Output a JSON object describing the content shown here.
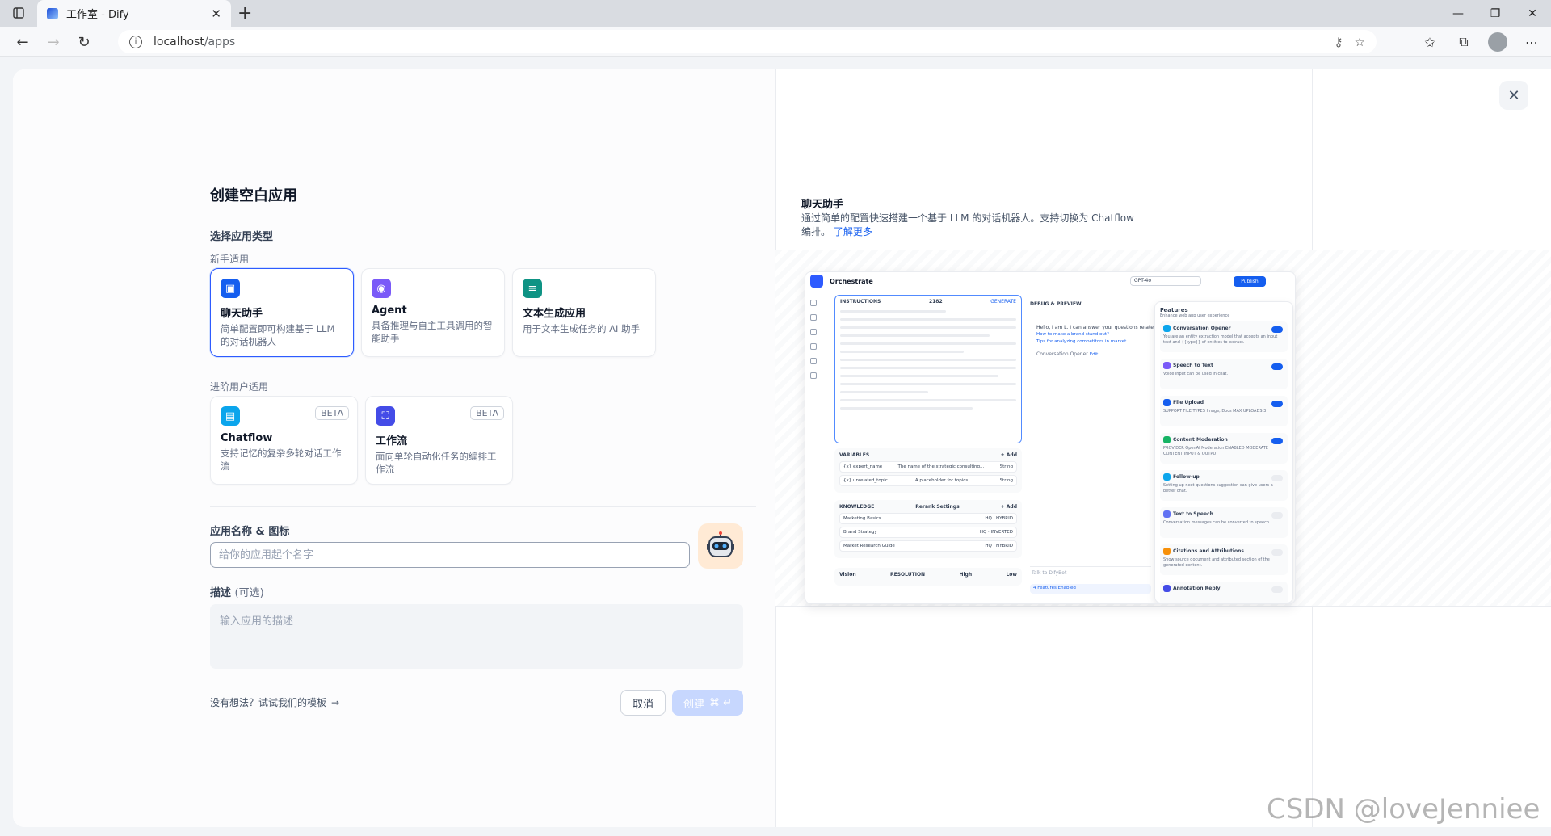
{
  "browser": {
    "tab_title": "工作室 - Dify",
    "url_host": "localhost",
    "url_path": "/apps"
  },
  "modal": {
    "title": "创建空白应用",
    "type_section": "选择应用类型",
    "beginner_label": "新手适用",
    "advanced_label": "进阶用户适用",
    "cards": [
      {
        "title": "聊天助手",
        "desc": "简单配置即可构建基于 LLM 的对话机器人",
        "color": "#155eef",
        "icon": "chat-bot-icon"
      },
      {
        "title": "Agent",
        "desc": "具备推理与自主工具调用的智能助手",
        "color": "#7a5af8",
        "icon": "agent-icon"
      },
      {
        "title": "文本生成应用",
        "desc": "用于文本生成任务的 AI 助手",
        "color": "#0e9384",
        "icon": "text-generation-icon"
      },
      {
        "title": "Chatflow",
        "desc": "支持记忆的复杂多轮对话工作流",
        "color": "#0ba5ec",
        "icon": "chatflow-icon",
        "badge": "BETA"
      },
      {
        "title": "工作流",
        "desc": "面向单轮自动化任务的编排工作流",
        "color": "#444ce7",
        "icon": "workflow-icon",
        "badge": "BETA"
      }
    ],
    "name_label": "应用名称 & 图标",
    "name_placeholder": "给你的应用起个名字",
    "desc_label": "描述",
    "desc_optional": "(可选)",
    "desc_placeholder": "输入应用的描述",
    "template_hint": "没有想法？试试我们的模板",
    "cancel_label": "取消",
    "create_label": "创建"
  },
  "preview": {
    "title": "聊天助手",
    "desc": "通过简单的配置快速搭建一个基于 LLM 的对话机器人。支持切换为 Chatflow 编排。",
    "more": "了解更多",
    "mini": {
      "orchestrate": "Orchestrate",
      "model": "GPT-4o",
      "publish": "Publish",
      "instructions": "INSTRUCTIONS",
      "instr_count": "2182",
      "generate": "GENERATE",
      "variables": "VARIABLES",
      "add": "+ Add",
      "variable_rows": [
        {
          "name": "{x} expert_name",
          "desc": "The name of the strategic consulting...",
          "type": "String"
        },
        {
          "name": "{x} unrelated_topic",
          "desc": "A placeholder for topics...",
          "type": "String"
        }
      ],
      "knowledge": "KNOWLEDGE",
      "rerank": "Rerank Settings",
      "knowledge_rows": [
        {
          "name": "Marketing Basics",
          "tag": "HQ · HYBRID"
        },
        {
          "name": "Brand Strategy",
          "tag": "HQ · INVERTED"
        },
        {
          "name": "Market Research Guide",
          "tag": "HQ · HYBRID"
        }
      ],
      "vision": "Vision",
      "resolution": "RESOLUTION",
      "high": "High",
      "low": "Low",
      "debug": "DEBUG & PREVIEW",
      "greeting": "Hello, I am L. I can answer your questions related",
      "q1": "How to make a brand stand out?",
      "q2": "Tips for analyzing competitors in market",
      "opener": "Conversation Opener",
      "edit": "Edit",
      "chat_placeholder": "Talk to DifyBot",
      "features_enabled": "4 Features Enabled",
      "features_title": "Features",
      "features_sub": "Enhance web app user experience",
      "features": [
        {
          "name": "Conversation Opener",
          "desc": "You are an entity extraction model that accepts an input text and {{type}} of entities to extract.",
          "on": true,
          "color": "#0ba5ec"
        },
        {
          "name": "Speech to Text",
          "desc": "Voice input can be used in chat.",
          "on": true,
          "color": "#7a5af8"
        },
        {
          "name": "File Upload",
          "desc": "SUPPORT FILE TYPES  Image, Docs   MAX UPLOADS 3",
          "on": true,
          "color": "#155eef"
        },
        {
          "name": "Content Moderation",
          "desc": "PROVIDER OpenAI Moderation   ENABLED MODERATE CONTENT INPUT & OUTPUT",
          "on": true,
          "color": "#16b364"
        },
        {
          "name": "Follow-up",
          "desc": "Setting up next questions suggestion can give users a better chat.",
          "on": false,
          "color": "#0ba5ec"
        },
        {
          "name": "Text to Speech",
          "desc": "Conversation messages can be converted to speech.",
          "on": false,
          "color": "#6172f3"
        },
        {
          "name": "Citations and Attributions",
          "desc": "Show source document and attributed section of the generated content.",
          "on": false,
          "color": "#f79009"
        },
        {
          "name": "Annotation Reply",
          "desc": "",
          "on": false,
          "color": "#444ce7"
        }
      ]
    }
  },
  "watermark": "CSDN @loveJenniee"
}
